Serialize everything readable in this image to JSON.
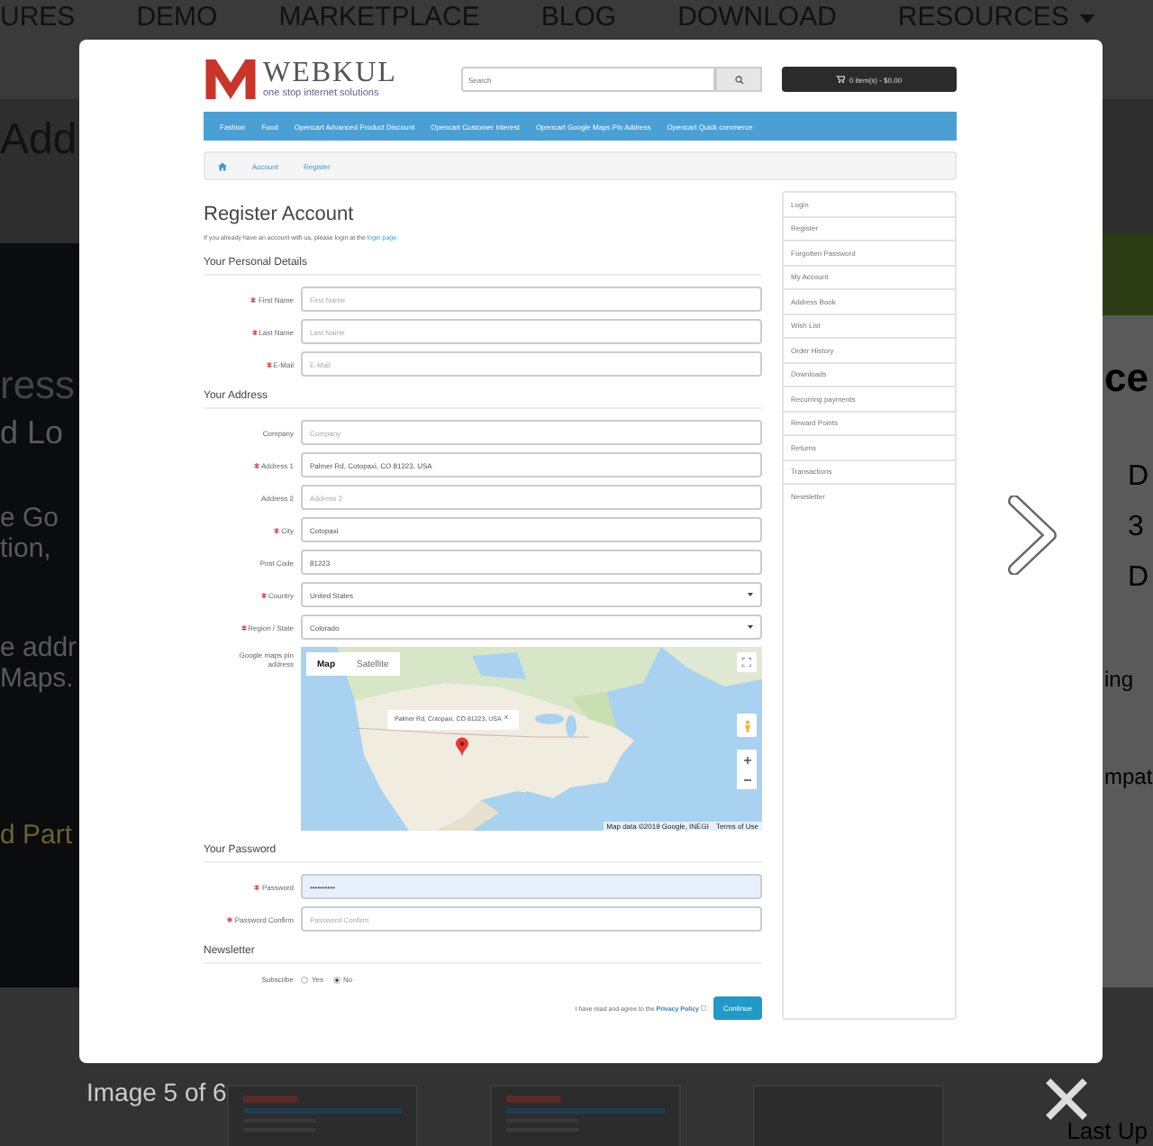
{
  "background_page": {
    "nav_items": [
      {
        "label": "URES",
        "has_caret": false
      },
      {
        "label": "DEMO",
        "has_caret": false
      },
      {
        "label": "MARKETPLACE",
        "has_caret": false
      },
      {
        "label": "BLOG",
        "has_caret": false
      },
      {
        "label": "DOWNLOAD",
        "has_caret": false
      },
      {
        "label": "RESOURCES",
        "has_caret": true
      }
    ],
    "heading": "Add",
    "left_texts": [
      {
        "text": "ress",
        "kind": "title"
      },
      {
        "text": "d Lo",
        "kind": "subtitle"
      },
      {
        "text": "e Go",
        "kind": "body"
      },
      {
        "text": "tion,",
        "kind": "body"
      },
      {
        "text": "e addr",
        "kind": "body"
      },
      {
        "text": "Maps.",
        "kind": "body"
      },
      {
        "text": "d Part",
        "kind": "link"
      }
    ],
    "right_texts": [
      {
        "text": "ce",
        "kind": "title"
      },
      {
        "text": "D",
        "kind": "item"
      },
      {
        "text": "3",
        "kind": "item"
      },
      {
        "text": "D",
        "kind": "item"
      },
      {
        "text": "ing",
        "kind": "body"
      },
      {
        "text": "mpat",
        "kind": "body"
      }
    ],
    "corner_text": "Last Up"
  },
  "lightbox": {
    "caption": "Image 5 of 6",
    "screenshot": {
      "header": {
        "brand": "WEBKUL",
        "tagline": "one stop internet solutions",
        "search_placeholder": "Search",
        "cart": "0 item(s) - $0.00"
      },
      "menu": [
        "Fashion",
        "Food",
        "Opencart Advanced Product Discount",
        "Opencart Customer Interest",
        "Opencart Google Maps Pin Address",
        "Opencart Quick commerce"
      ],
      "breadcrumb": [
        "Account",
        "Register"
      ],
      "title": "Register Account",
      "intro_text": "If you already have an account with us, please login at the",
      "intro_link": "login page.",
      "sections": [
        {
          "legend": "Your Personal Details",
          "fields": [
            {
              "kind": "text",
              "label": "First Name",
              "required": true,
              "placeholder": "First Name",
              "highlighted": false
            },
            {
              "kind": "text",
              "label": "Last Name",
              "required": true,
              "placeholder": "Last Name",
              "highlighted": false
            },
            {
              "kind": "text",
              "label": "E-Mail",
              "required": true,
              "placeholder": "E-Mail",
              "highlighted": false
            }
          ]
        },
        {
          "legend": "Your Address",
          "fields": [
            {
              "kind": "text",
              "label": "Company",
              "required": false,
              "placeholder": "Company",
              "highlighted": false
            },
            {
              "kind": "text",
              "label": "Address 1",
              "required": true,
              "value": "Palmer Rd, Cotopaxi, CO 81223, USA",
              "highlighted": false
            },
            {
              "kind": "text",
              "label": "Address 2",
              "required": false,
              "placeholder": "Address 2",
              "highlighted": false
            },
            {
              "kind": "text",
              "label": "City",
              "required": true,
              "value": "Cotopaxi",
              "highlighted": false
            },
            {
              "kind": "text",
              "label": "Post Code",
              "required": false,
              "value": "81223",
              "highlighted": false
            },
            {
              "kind": "select",
              "label": "Country",
              "required": true,
              "value": "United States"
            },
            {
              "kind": "select",
              "label": "Region / State",
              "required": true,
              "value": "Colorado"
            },
            {
              "kind": "map",
              "label": "Google maps pin address",
              "required": false,
              "map_types": [
                {
                  "label": "Map",
                  "selected": true
                },
                {
                  "label": "Satellite",
                  "selected": false
                }
              ],
              "info_window": "Palmer Rd, Cotopaxi, CO 81223, USA",
              "attribution": "Map data ©2019 Google, INEGI",
              "terms": "Terms of Use"
            }
          ]
        },
        {
          "legend": "Your Password",
          "fields": [
            {
              "kind": "text",
              "label": "Password",
              "required": true,
              "value": "••••••••••",
              "highlighted": true
            },
            {
              "kind": "text",
              "label": "Password Confirm",
              "required": true,
              "placeholder": "Password Confirm",
              "highlighted": false
            }
          ]
        },
        {
          "legend": "Newsletter",
          "fields": [
            {
              "kind": "radio",
              "label": "Subscribe",
              "required": false,
              "options": [
                {
                  "label": "Yes",
                  "selected": false
                },
                {
                  "label": "No",
                  "selected": true
                }
              ]
            }
          ]
        }
      ],
      "agreement": {
        "text": "I have read and agree to the",
        "link": "Privacy Policy",
        "checked": false
      },
      "continue_button": "Continue",
      "account_links": [
        "Login",
        "Register",
        "Forgotten Password",
        "My Account",
        "Address Book",
        "Wish List",
        "Order History",
        "Downloads",
        "Recurring payments",
        "Reward Points",
        "Returns",
        "Transactions",
        "Newsletter"
      ]
    }
  }
}
